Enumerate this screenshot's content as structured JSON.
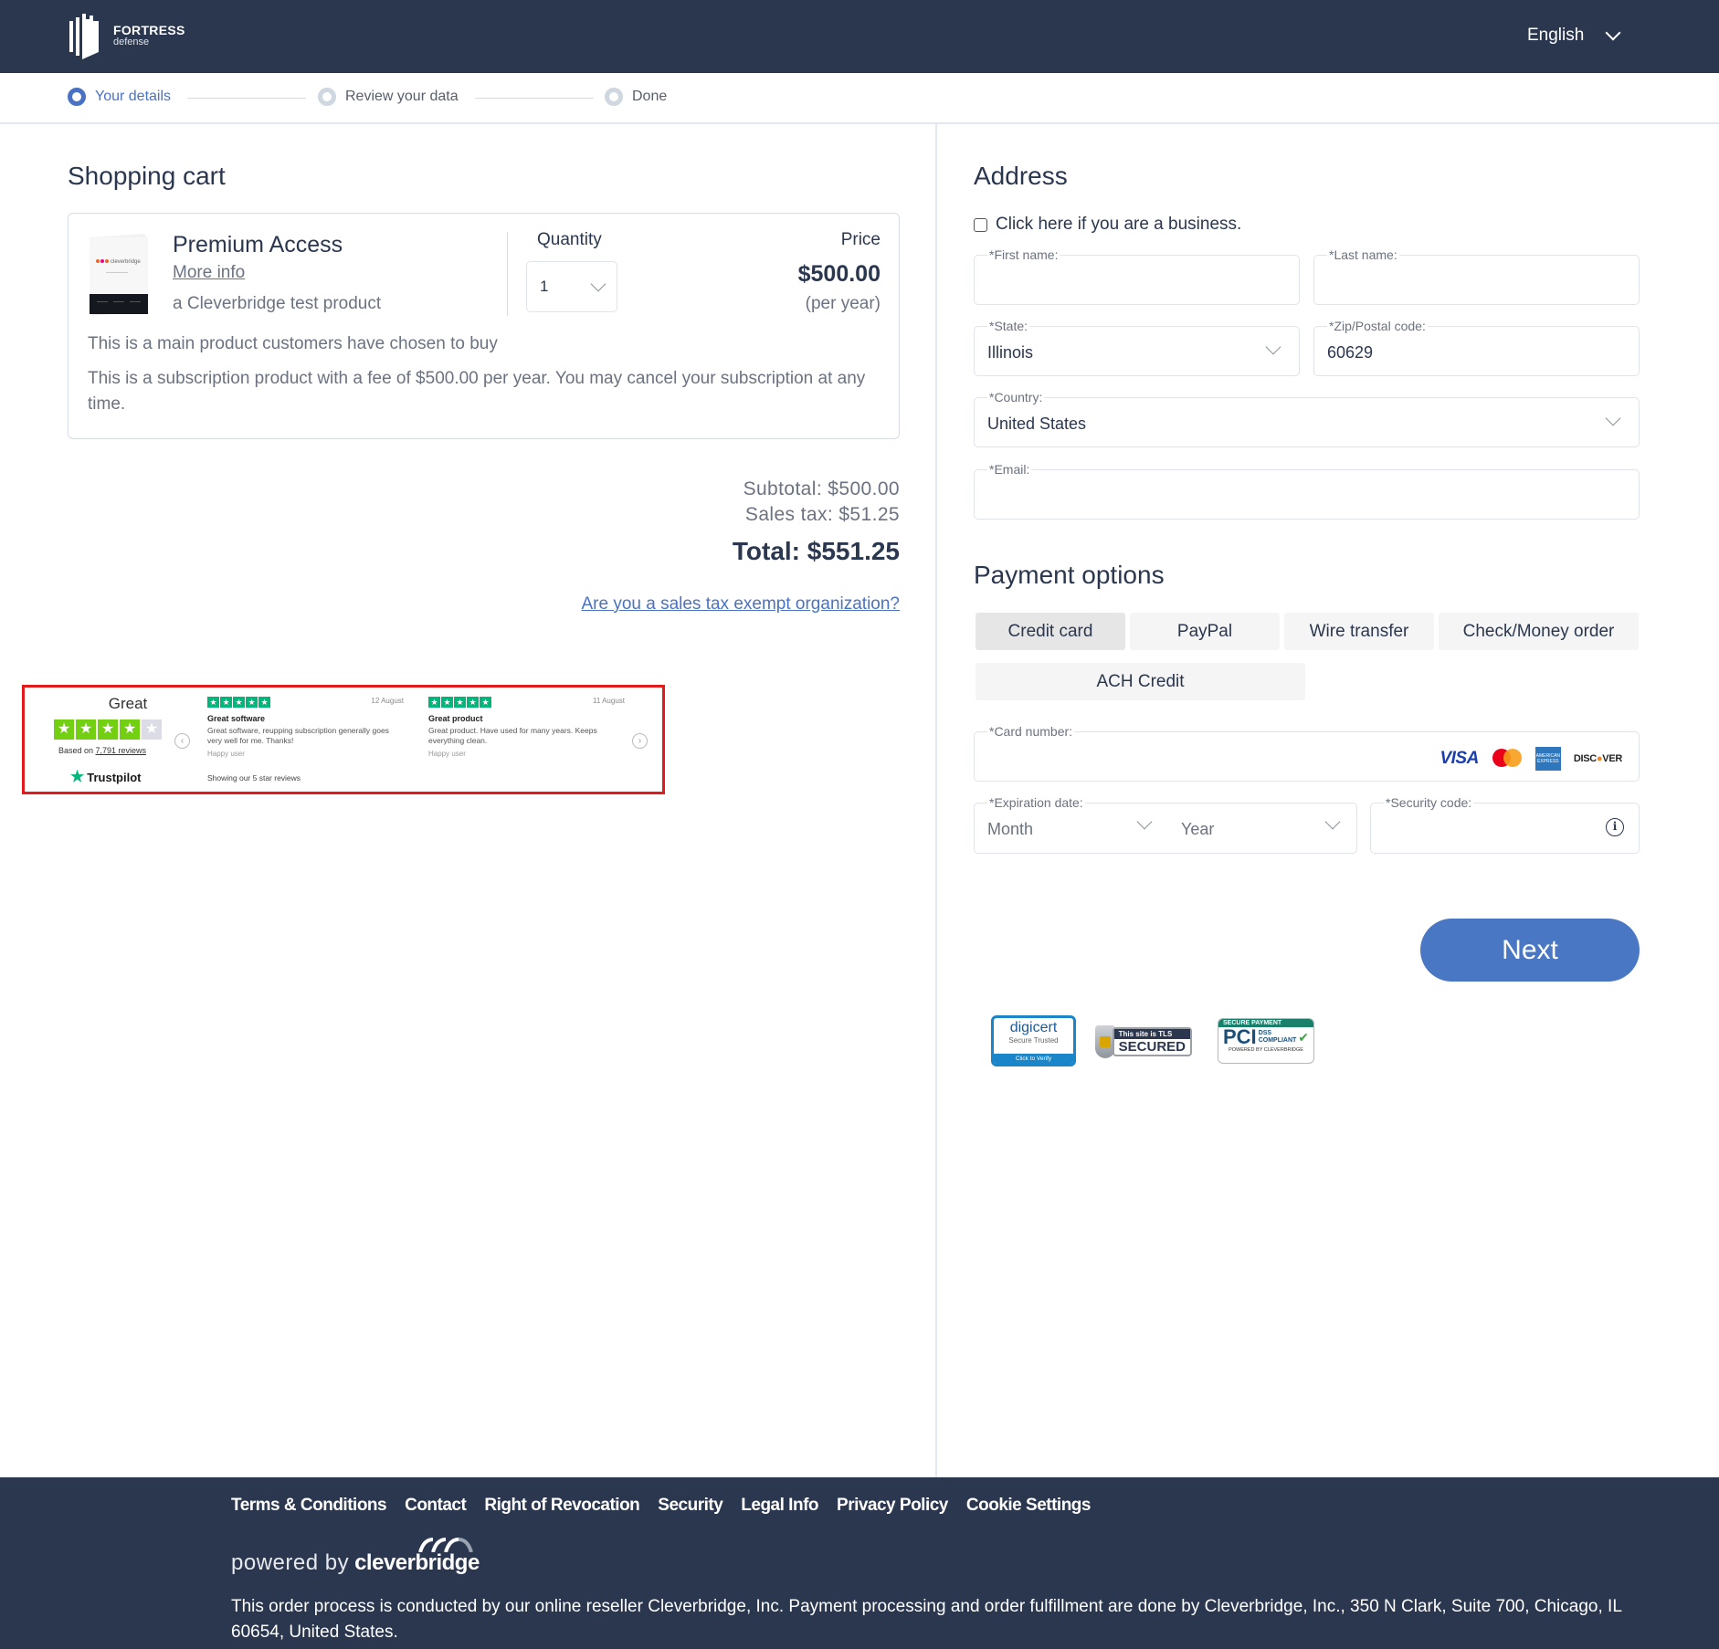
{
  "header": {
    "brand": "FORTRESS",
    "brand_sub": "defense",
    "language": "English"
  },
  "steps": [
    {
      "label": "Your details",
      "state": "active"
    },
    {
      "label": "Review your data",
      "state": "pending"
    },
    {
      "label": "Done",
      "state": "pending"
    }
  ],
  "cart": {
    "title": "Shopping cart",
    "product": {
      "name": "Premium Access",
      "more_info": "More info",
      "subtitle": "a Cleverbridge test product",
      "image_brand": "cleverbridge",
      "quantity_label": "Quantity",
      "quantity": "1",
      "price_label": "Price",
      "price": "$500.00",
      "period": "(per year)",
      "description1": "This is a main product customers have chosen to buy",
      "description2": "This is a subscription product with a fee of $500.00 per year. You may cancel your subscription at any time."
    },
    "subtotal": "Subtotal: $500.00",
    "sales_tax": "Sales tax: $51.25",
    "total": "Total: $551.25",
    "tax_exempt_link": "Are you a sales tax exempt organization?"
  },
  "trustpilot": {
    "rating_word": "Great",
    "stars": 4,
    "based_on_prefix": "Based on ",
    "reviews_count": "7,791 reviews",
    "brand": "Trustpilot",
    "showing": "Showing our 5 star reviews",
    "reviews": [
      {
        "date": "12 August",
        "title": "Great software",
        "text": "Great software, reupping subscription generally goes very well for me. Thanks!",
        "author": "Happy user"
      },
      {
        "date": "11 August",
        "title": "Great product",
        "text": "Great product. Have used for many years. Keeps everything clean.",
        "author": "Happy user"
      }
    ]
  },
  "address": {
    "title": "Address",
    "business_checkbox": "Click here if you are a business.",
    "business_checked": false,
    "first_name_label": "*First name:",
    "first_name": "",
    "last_name_label": "*Last name:",
    "last_name": "",
    "state_label": "*State:",
    "state": "Illinois",
    "zip_label": "*Zip/Postal code:",
    "zip": "60629",
    "country_label": "*Country:",
    "country": "United States",
    "email_label": "*Email:",
    "email": ""
  },
  "payment": {
    "title": "Payment options",
    "tabs": [
      {
        "label": "Credit card",
        "active": true
      },
      {
        "label": "PayPal",
        "active": false
      },
      {
        "label": "Wire transfer",
        "active": false
      },
      {
        "label": "Check/Money order",
        "active": false
      },
      {
        "label": "ACH Credit",
        "active": false
      }
    ],
    "card_number_label": "*Card number:",
    "card_brands": [
      "VISA",
      "Mastercard",
      "American Express",
      "DISCOVER"
    ],
    "expiration_label": "*Expiration date:",
    "month_placeholder": "Month",
    "year_placeholder": "Year",
    "security_label": "*Security code:",
    "next_button": "Next"
  },
  "badges": {
    "digicert": {
      "name": "digicert",
      "line2": "Secure  Trusted",
      "line3": "Click to Verify"
    },
    "tls": {
      "top": "This site is TLS",
      "bottom": "SECURED"
    },
    "pci": {
      "top": "SECURE PAYMENT",
      "big": "PCI",
      "small1": "DSS",
      "small2": "COMPLIANT",
      "bottom": "POWERED BY CLEVERBRIDGE"
    }
  },
  "footer": {
    "links": [
      "Terms & Conditions",
      "Contact",
      "Right of Revocation",
      "Security",
      "Legal Info",
      "Privacy Policy",
      "Cookie Settings"
    ],
    "powered_by": "powered by",
    "powered_brand": "cleverbridge",
    "legal": "This order process is conducted by our online reseller Cleverbridge, Inc. Payment processing and order fulfillment are done by Cleverbridge, Inc., 350 N Clark, Suite 700, Chicago, IL 60654, United States."
  },
  "colors": {
    "header_bg": "#2a374f",
    "accent": "#4a77c4",
    "highlight_border": "#e31b1b",
    "trustpilot_green": "#00b67a"
  }
}
